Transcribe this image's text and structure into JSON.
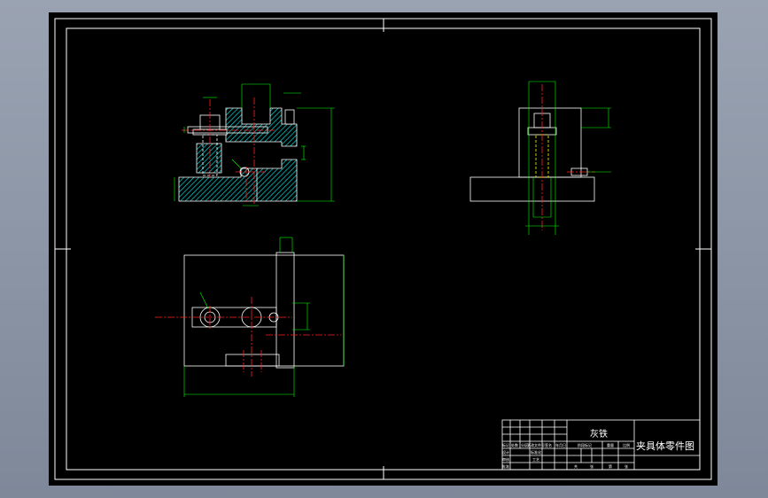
{
  "title_block": {
    "material": "灰铁",
    "drawing_title": "夹具体零件图",
    "row_labels": [
      "标记",
      "处数",
      "分区",
      "更改文件号",
      "签名",
      "年月日"
    ],
    "stage_labels": [
      "阶段标记",
      "重量",
      "比例"
    ],
    "bottom_labels": [
      "设计",
      "标准化",
      "审核",
      "工艺",
      "批准"
    ],
    "sheet_labels": [
      "共",
      "张",
      "第",
      "张"
    ]
  },
  "colors": {
    "background": "#000000",
    "frame": "#ffffff",
    "dimension": "#00ff00",
    "centerline": "#ff0000",
    "hatch": "#00ffff",
    "hidden": "#ffff00"
  }
}
